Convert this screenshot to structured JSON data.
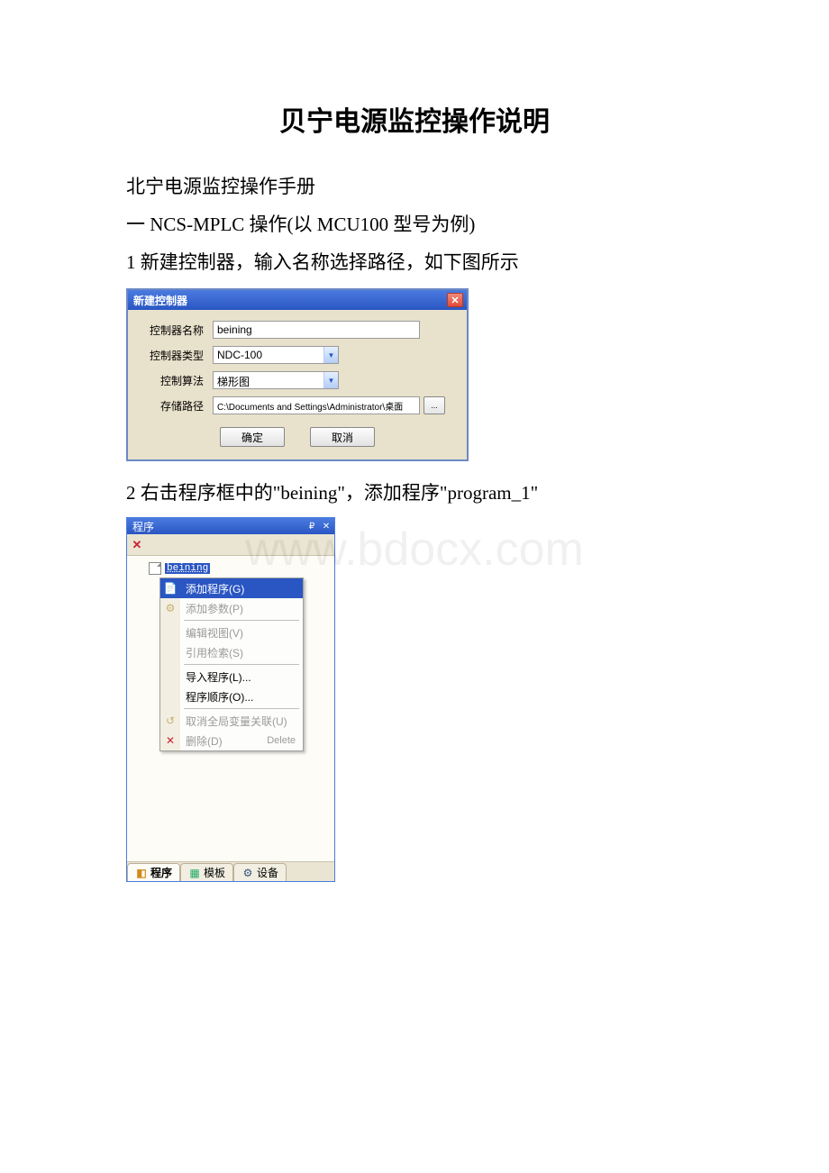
{
  "doc": {
    "title": "贝宁电源监控操作说明",
    "line_manual": "北宁电源监控操作手册",
    "line_section1_a": "一 ",
    "line_section1_b": "NCS-MPLC",
    "line_section1_c": " 操作(以 ",
    "line_section1_d": "MCU100",
    "line_section1_e": " 型号为例)",
    "line_step1": "1 新建控制器，输入名称选择路径，如下图所示",
    "line_step2_a": "2 右击程序框中的\"",
    "line_step2_b": "beining",
    "line_step2_c": "\"，添加程序\"",
    "line_step2_d": "program_1",
    "line_step2_e": "\""
  },
  "watermark": "www.bdocx.com",
  "fig1": {
    "title": "新建控制器",
    "labels": {
      "name": "控制器名称",
      "type": "控制器类型",
      "algo": "控制算法",
      "path": "存储路径"
    },
    "values": {
      "name": "beining",
      "type": "NDC-100",
      "algo": "梯形图",
      "path": "C:\\Documents and Settings\\Administrator\\桌面"
    },
    "browse": "...",
    "ok": "确定",
    "cancel": "取消"
  },
  "fig2": {
    "title": "程序",
    "selected_node": "beining",
    "menu": {
      "add_program": "添加程序(G)",
      "add_param": "添加参数(P)",
      "edit_view": "编辑视图(V)",
      "ref_search": "引用检索(S)",
      "import_program": "导入程序(L)...",
      "program_order": "程序顺序(O)...",
      "cancel_global": "取消全局变量关联(U)",
      "delete": "删除(D)",
      "delete_shortcut": "Delete"
    },
    "tabs": {
      "program": "程序",
      "template": "模板",
      "device": "设备"
    }
  }
}
